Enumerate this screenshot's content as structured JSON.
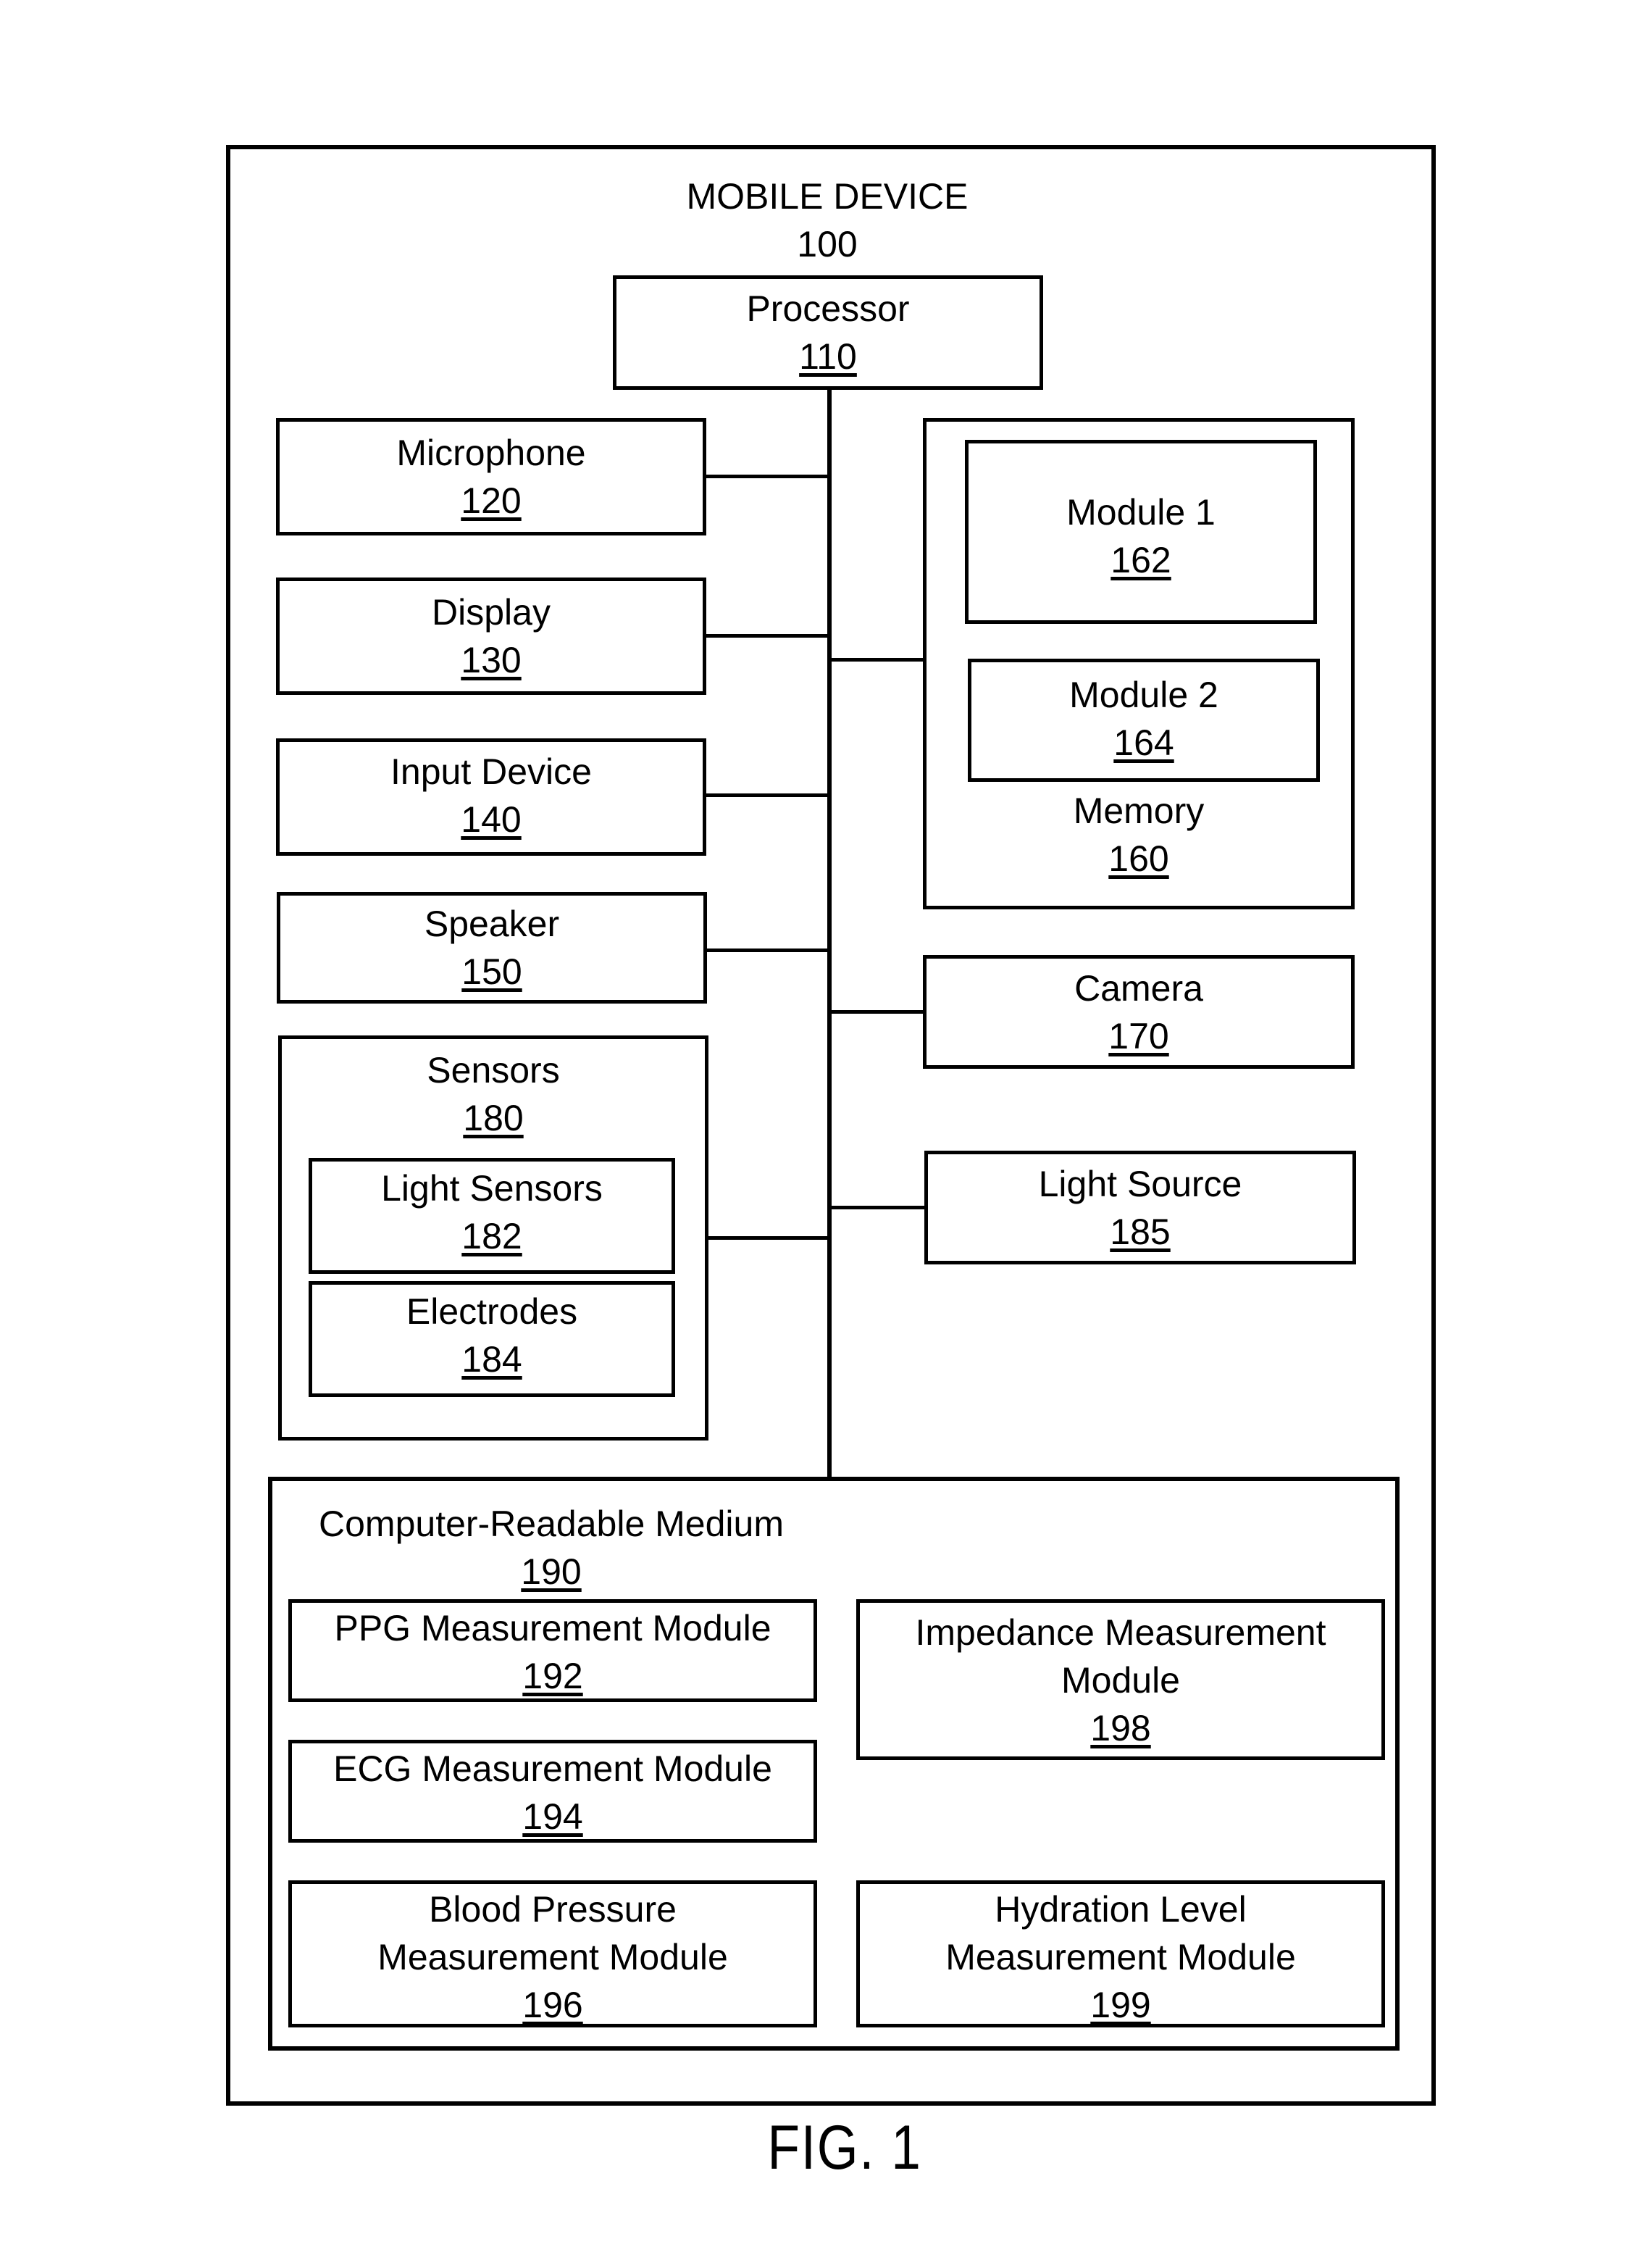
{
  "figure": {
    "caption": "FIG. 1",
    "device": {
      "name": "MOBILE DEVICE",
      "ref": "100"
    }
  },
  "components": {
    "processor": {
      "name": "Processor",
      "ref": "110"
    },
    "microphone": {
      "name": "Microphone",
      "ref": "120"
    },
    "display": {
      "name": "Display",
      "ref": "130"
    },
    "input_device": {
      "name": "Input Device",
      "ref": "140"
    },
    "speaker": {
      "name": "Speaker",
      "ref": "150"
    },
    "memory": {
      "name": "Memory",
      "ref": "160",
      "module1": {
        "name": "Module 1",
        "ref": "162"
      },
      "module2": {
        "name": "Module 2",
        "ref": "164"
      }
    },
    "camera": {
      "name": "Camera",
      "ref": "170"
    },
    "sensors": {
      "name": "Sensors",
      "ref": "180",
      "light_sensors": {
        "name": "Light Sensors",
        "ref": "182"
      },
      "electrodes": {
        "name": "Electrodes",
        "ref": "184"
      }
    },
    "light_source": {
      "name": "Light Source",
      "ref": "185"
    },
    "crm": {
      "name": "Computer-Readable Medium",
      "ref": "190",
      "ppg": {
        "line1": "PPG Measurement Module",
        "ref": "192"
      },
      "ecg": {
        "line1": "ECG Measurement Module",
        "ref": "194"
      },
      "bp": {
        "line1": "Blood Pressure",
        "line2": "Measurement Module",
        "ref": "196"
      },
      "impedance": {
        "line1": "Impedance Measurement",
        "line2": "Module",
        "ref": "198"
      },
      "hydration": {
        "line1": "Hydration Level",
        "line2": "Measurement Module",
        "ref": "199"
      }
    }
  }
}
